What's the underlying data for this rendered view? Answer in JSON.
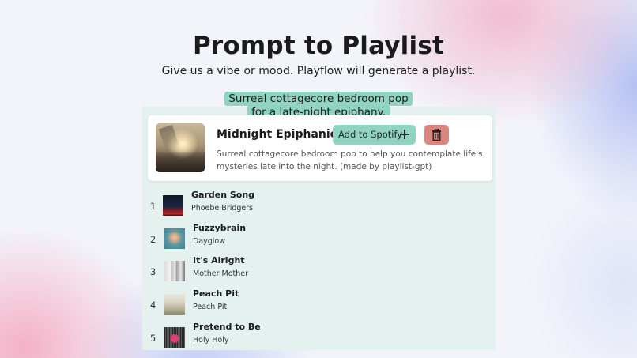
{
  "header": {
    "title": "Prompt to Playlist",
    "subtitle": "Give us a vibe or mood. Playflow will generate a playlist."
  },
  "prompt": {
    "line1": "Surreal cottagecore bedroom pop",
    "line2": "for a late-night epiphany."
  },
  "playlist": {
    "name": "Midnight Epiphanies",
    "add_button_label": "Add to Spotify",
    "description": "Surreal cottagecore bedroom pop to help you contemplate life's mysteries late into the night. (made by playlist-gpt)"
  },
  "tracks": [
    {
      "number": "1",
      "title": "Garden Song",
      "artist": "Phoebe Bridgers"
    },
    {
      "number": "2",
      "title": "Fuzzybrain",
      "artist": "Dayglow"
    },
    {
      "number": "3",
      "title": "It's Alright",
      "artist": "Mother Mother"
    },
    {
      "number": "4",
      "title": "Peach Pit",
      "artist": "Peach Pit"
    },
    {
      "number": "5",
      "title": "Pretend to Be",
      "artist": "Holy Holy"
    }
  ],
  "colors": {
    "accent": "#8fd3c0",
    "danger": "#d9877e",
    "panel": "#e4f1ee"
  },
  "icons": {
    "add": "plus-icon",
    "delete": "trash-icon"
  }
}
